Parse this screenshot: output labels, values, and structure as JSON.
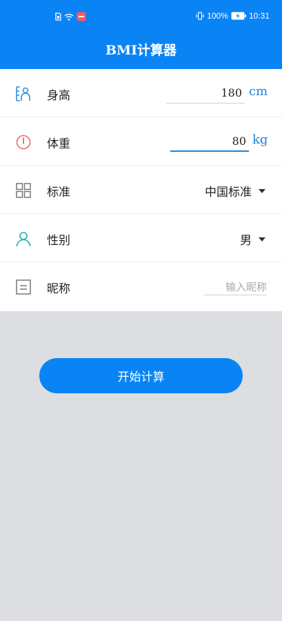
{
  "status_bar": {
    "battery": "100%",
    "time": "10:31"
  },
  "app_bar": {
    "title": "BMI计算器"
  },
  "form": {
    "height": {
      "label": "身高",
      "value": "180",
      "unit": "cm"
    },
    "weight": {
      "label": "体重",
      "value": "80",
      "unit": "kg"
    },
    "standard": {
      "label": "标准",
      "selected": "中国标准"
    },
    "gender": {
      "label": "性别",
      "selected": "男"
    },
    "nickname": {
      "label": "昵称",
      "placeholder": "输入昵称"
    }
  },
  "actions": {
    "calculate_label": "开始计算"
  },
  "colors": {
    "primary": "#0a84f5",
    "unit": "#1585e0",
    "background": "#dcdee2"
  }
}
